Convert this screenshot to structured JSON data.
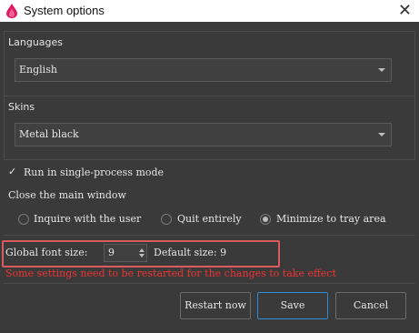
{
  "window": {
    "title": "System options"
  },
  "languages": {
    "label": "Languages",
    "selected": "English"
  },
  "skins": {
    "label": "Skins",
    "selected": "Metal black"
  },
  "options": {
    "run_single_process": {
      "label": "Run in single-process mode",
      "checked": true
    },
    "close_main_window": {
      "label": "Close the main window",
      "choices": [
        "Inquire with the user",
        "Quit entirely",
        "Minimize to tray area"
      ],
      "selected": "Minimize to tray area"
    }
  },
  "fonts": {
    "global_label": "Global font size:",
    "global_value": "9",
    "default_label": "Default size: 9"
  },
  "warning": "Some settings need to be restarted for the changes to take effect",
  "buttons": {
    "restart": "Restart now",
    "save": "Save",
    "cancel": "Cancel"
  },
  "colors": {
    "accent": "#2f8ad1",
    "warning": "#e33333",
    "highlight": "#d95b5b"
  },
  "icons": {
    "app": "app-logo-icon",
    "close": "close-icon",
    "check": "check-icon"
  }
}
